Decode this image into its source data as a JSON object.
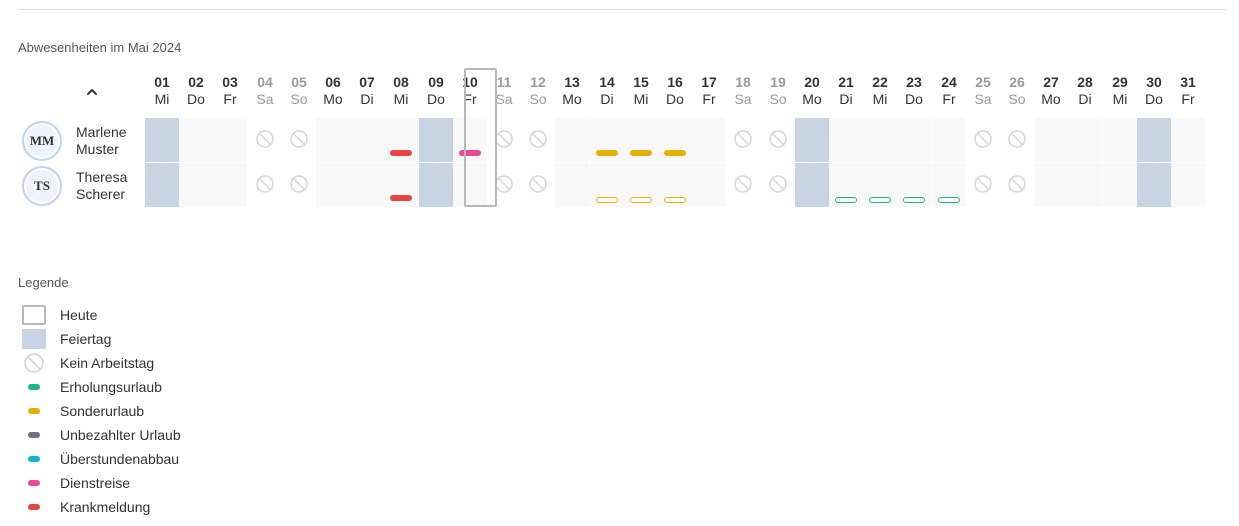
{
  "section_title": "Abwesenheiten im Mai 2024",
  "collapse_icon": "chevron-up-icon",
  "days": [
    {
      "num": "01",
      "name": "Mi",
      "weekend": false,
      "holiday": true
    },
    {
      "num": "02",
      "name": "Do",
      "weekend": false,
      "holiday": false
    },
    {
      "num": "03",
      "name": "Fr",
      "weekend": false,
      "holiday": false
    },
    {
      "num": "04",
      "name": "Sa",
      "weekend": true,
      "holiday": false
    },
    {
      "num": "05",
      "name": "So",
      "weekend": true,
      "holiday": false
    },
    {
      "num": "06",
      "name": "Mo",
      "weekend": false,
      "holiday": false
    },
    {
      "num": "07",
      "name": "Di",
      "weekend": false,
      "holiday": false
    },
    {
      "num": "08",
      "name": "Mi",
      "weekend": false,
      "holiday": false
    },
    {
      "num": "09",
      "name": "Do",
      "weekend": false,
      "holiday": true
    },
    {
      "num": "10",
      "name": "Fr",
      "weekend": false,
      "holiday": false,
      "today": true
    },
    {
      "num": "11",
      "name": "Sa",
      "weekend": true,
      "holiday": false
    },
    {
      "num": "12",
      "name": "So",
      "weekend": true,
      "holiday": false
    },
    {
      "num": "13",
      "name": "Mo",
      "weekend": false,
      "holiday": false
    },
    {
      "num": "14",
      "name": "Di",
      "weekend": false,
      "holiday": false
    },
    {
      "num": "15",
      "name": "Mi",
      "weekend": false,
      "holiday": false
    },
    {
      "num": "16",
      "name": "Do",
      "weekend": false,
      "holiday": false
    },
    {
      "num": "17",
      "name": "Fr",
      "weekend": false,
      "holiday": false
    },
    {
      "num": "18",
      "name": "Sa",
      "weekend": true,
      "holiday": false
    },
    {
      "num": "19",
      "name": "So",
      "weekend": true,
      "holiday": false
    },
    {
      "num": "20",
      "name": "Mo",
      "weekend": false,
      "holiday": true
    },
    {
      "num": "21",
      "name": "Di",
      "weekend": false,
      "holiday": false
    },
    {
      "num": "22",
      "name": "Mi",
      "weekend": false,
      "holiday": false
    },
    {
      "num": "23",
      "name": "Do",
      "weekend": false,
      "holiday": false
    },
    {
      "num": "24",
      "name": "Fr",
      "weekend": false,
      "holiday": false
    },
    {
      "num": "25",
      "name": "Sa",
      "weekend": true,
      "holiday": false
    },
    {
      "num": "26",
      "name": "So",
      "weekend": true,
      "holiday": false
    },
    {
      "num": "27",
      "name": "Mo",
      "weekend": false,
      "holiday": false
    },
    {
      "num": "28",
      "name": "Di",
      "weekend": false,
      "holiday": false
    },
    {
      "num": "29",
      "name": "Mi",
      "weekend": false,
      "holiday": false
    },
    {
      "num": "30",
      "name": "Do",
      "weekend": false,
      "holiday": true
    },
    {
      "num": "31",
      "name": "Fr",
      "weekend": false,
      "holiday": false
    }
  ],
  "employees": [
    {
      "initials": "MM",
      "first_name": "Marlene",
      "last_name": "Muster",
      "absences": [
        {
          "day": "08",
          "type": "krankmeldung",
          "style": "solid"
        },
        {
          "day": "10",
          "type": "dienstreise",
          "style": "solid"
        },
        {
          "day": "14",
          "type": "sonderurlaub",
          "style": "solid"
        },
        {
          "day": "15",
          "type": "sonderurlaub",
          "style": "solid"
        },
        {
          "day": "16",
          "type": "sonderurlaub",
          "style": "solid"
        }
      ]
    },
    {
      "initials": "TS",
      "first_name": "Theresa",
      "last_name": "Scherer",
      "absences": [
        {
          "day": "08",
          "type": "krankmeldung",
          "style": "solid"
        },
        {
          "day": "14",
          "type": "sonderurlaub",
          "style": "pending"
        },
        {
          "day": "15",
          "type": "sonderurlaub",
          "style": "pending"
        },
        {
          "day": "16",
          "type": "sonderurlaub",
          "style": "pending"
        },
        {
          "day": "21",
          "type": "erholungsurlaub",
          "style": "pending"
        },
        {
          "day": "22",
          "type": "erholungsurlaub",
          "style": "pending"
        },
        {
          "day": "23",
          "type": "erholungsurlaub",
          "style": "pending"
        },
        {
          "day": "24",
          "type": "erholungsurlaub",
          "style": "pending"
        }
      ]
    }
  ],
  "absence_colors": {
    "erholungsurlaub": "#1db87e",
    "sonderurlaub": "#e6b000",
    "unbezahlter_urlaub": "#6b7280",
    "ueberstundenabbau": "#14b8c4",
    "dienstreise": "#e8489a",
    "krankmeldung": "#e84444"
  },
  "legend": {
    "title": "Legende",
    "items": [
      {
        "key": "heute",
        "label": "Heute",
        "symbol": "today"
      },
      {
        "key": "feiertag",
        "label": "Feiertag",
        "symbol": "holiday"
      },
      {
        "key": "kein_arbeitstag",
        "label": "Kein Arbeitstag",
        "symbol": "nowork"
      },
      {
        "key": "erholungsurlaub",
        "label": "Erholungsurlaub",
        "symbol": "dot",
        "color": "#1db87e"
      },
      {
        "key": "sonderurlaub",
        "label": "Sonderurlaub",
        "symbol": "dot",
        "color": "#e6b000"
      },
      {
        "key": "unbezahlter_urlaub",
        "label": "Unbezahlter Urlaub",
        "symbol": "dot",
        "color": "#6b7280"
      },
      {
        "key": "ueberstundenabbau",
        "label": "Überstundenabbau",
        "symbol": "dot",
        "color": "#14b8c4"
      },
      {
        "key": "dienstreise",
        "label": "Dienstreise",
        "symbol": "dot",
        "color": "#e8489a"
      },
      {
        "key": "krankmeldung",
        "label": "Krankmeldung",
        "symbol": "dot",
        "color": "#e84444"
      }
    ]
  }
}
